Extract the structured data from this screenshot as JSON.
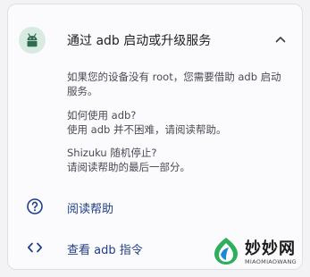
{
  "card": {
    "title": "通过 adb 启动或升级服务",
    "paragraph1": "如果您的设备没有 root，您需要借助 adb 启动服务。",
    "paragraph2_title": "如何使用 adb?",
    "paragraph2_text": "使用 adb 并不困难，请阅读帮助。",
    "paragraph3_title": "Shizuku 随机停止?",
    "paragraph3_text": "请阅读帮助的最后一部分。"
  },
  "actions": [
    {
      "label": "阅读帮助",
      "icon": "help-circle-icon"
    },
    {
      "label": "查看 adb 指令",
      "icon": "code-icon"
    }
  ],
  "header_icon": "android-robot-icon",
  "collapse_icon": "chevron-up-icon",
  "watermark": {
    "title": "妙妙网",
    "subtitle": "MIAOMIAOWANG"
  },
  "colors": {
    "accent": "#1f3f84",
    "robot_bg": "#d7ebe1",
    "robot_fg": "#2e6b4f",
    "text_primary": "#202124",
    "text_secondary": "#4a4a54"
  }
}
